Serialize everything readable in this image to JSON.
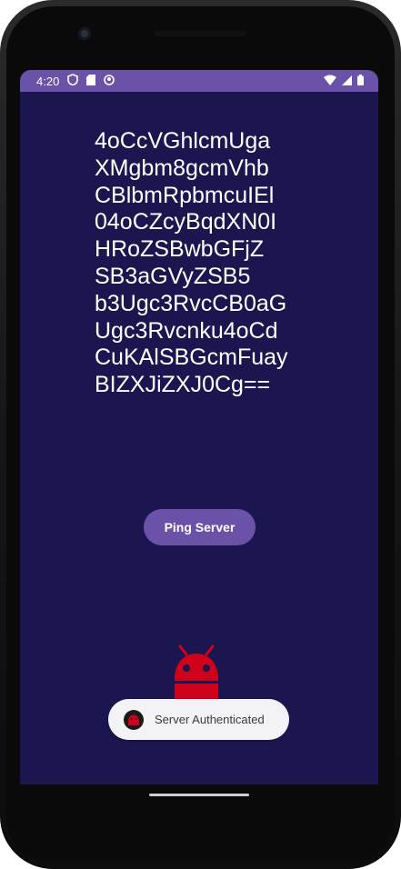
{
  "status_bar": {
    "time": "4:20",
    "left_icons": [
      "shield-icon",
      "sd-card-icon",
      "notification-icon"
    ],
    "right_icons": [
      "wifi-icon",
      "signal-icon",
      "battery-icon"
    ]
  },
  "content": {
    "encoded_text": "4oCcVGhlcmUga\nXMgbm8gcmVhb\nCBlbmRpbmcuIEl\n04oCZcyBqdXN0I\nHRoZSBwbGFjZ\nSB3aGVyZSB5\nb3Ugc3RvcCB0aG\nUgc3Rvcnku4oCd\nCuKAlSBGcmFuay\nBIZXJiZXJ0Cg=="
  },
  "ping_button": {
    "label": "Ping Server"
  },
  "toast": {
    "message": "Server Authenticated",
    "icon": "android-icon"
  },
  "colors": {
    "background": "#1c1650",
    "accent": "#6a52a8",
    "android_red": "#d0021b"
  }
}
